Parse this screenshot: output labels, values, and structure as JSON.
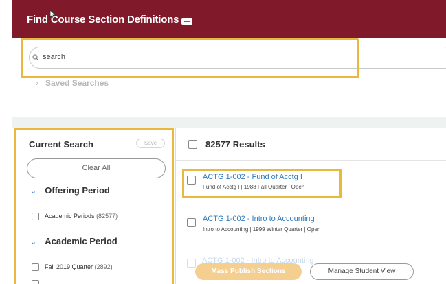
{
  "header": {
    "title": "Find Course Section Definitions"
  },
  "search": {
    "value": "search"
  },
  "saved_searches": {
    "label": "Saved Searches"
  },
  "current_search": {
    "title": "Current Search",
    "save_label": "Save",
    "clear_all_label": "Clear All"
  },
  "facets": [
    {
      "title": "Offering Period",
      "items": [
        {
          "label": "Academic Periods",
          "count": "(82577)"
        }
      ]
    },
    {
      "title": "Academic Period",
      "items": [
        {
          "label": "Fall 2019 Quarter",
          "count": "(2892)"
        }
      ]
    }
  ],
  "results": {
    "count_label": "82577 Results",
    "rows": [
      {
        "title": "ACTG 1-002 - Fund of Acctg I",
        "subtitle": "Fund of Acctg I | 1988 Fall Quarter | Open"
      },
      {
        "title": "ACTG 1-002 - Intro to Accounting",
        "subtitle": "Intro to Accounting | 1999 Winter Quarter | Open"
      },
      {
        "title": "ACTG 1-002 - Intro to Accounting",
        "subtitle": ""
      }
    ]
  },
  "actions": {
    "primary_label": "Mass Publish Sections",
    "secondary_label": "Manage Student View"
  },
  "colors": {
    "header_bg": "#80192a",
    "highlight": "#e8b93c",
    "link": "#2e7bbf",
    "primary_button": "#f5cf8f"
  }
}
